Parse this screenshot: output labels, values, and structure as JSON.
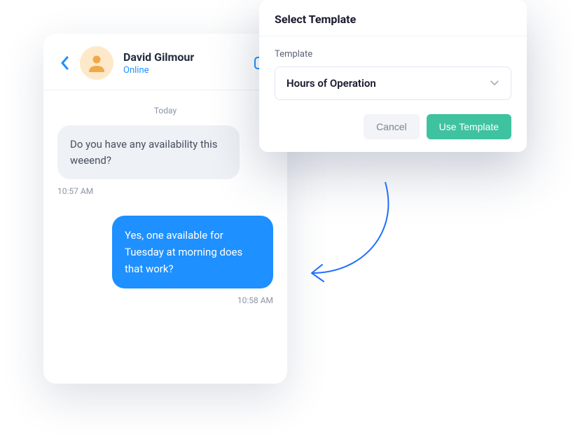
{
  "chat": {
    "contact_name": "David Gilmour",
    "status": "Online",
    "date_separator": "Today",
    "messages": [
      {
        "direction": "in",
        "text": "Do you have any availability this weeend?",
        "time": "10:57 AM"
      },
      {
        "direction": "out",
        "text": "Yes, one available for Tuesday at morning does that work?",
        "time": "10:58 AM"
      }
    ]
  },
  "modal": {
    "title": "Select Template",
    "field_label": "Template",
    "selected_value": "Hours of Operation",
    "cancel_label": "Cancel",
    "confirm_label": "Use Template"
  },
  "colors": {
    "accent_blue": "#1e90ff",
    "accent_teal": "#3fc2a0",
    "avatar_bg": "#fde9c9",
    "avatar_fg": "#f0a94a"
  }
}
